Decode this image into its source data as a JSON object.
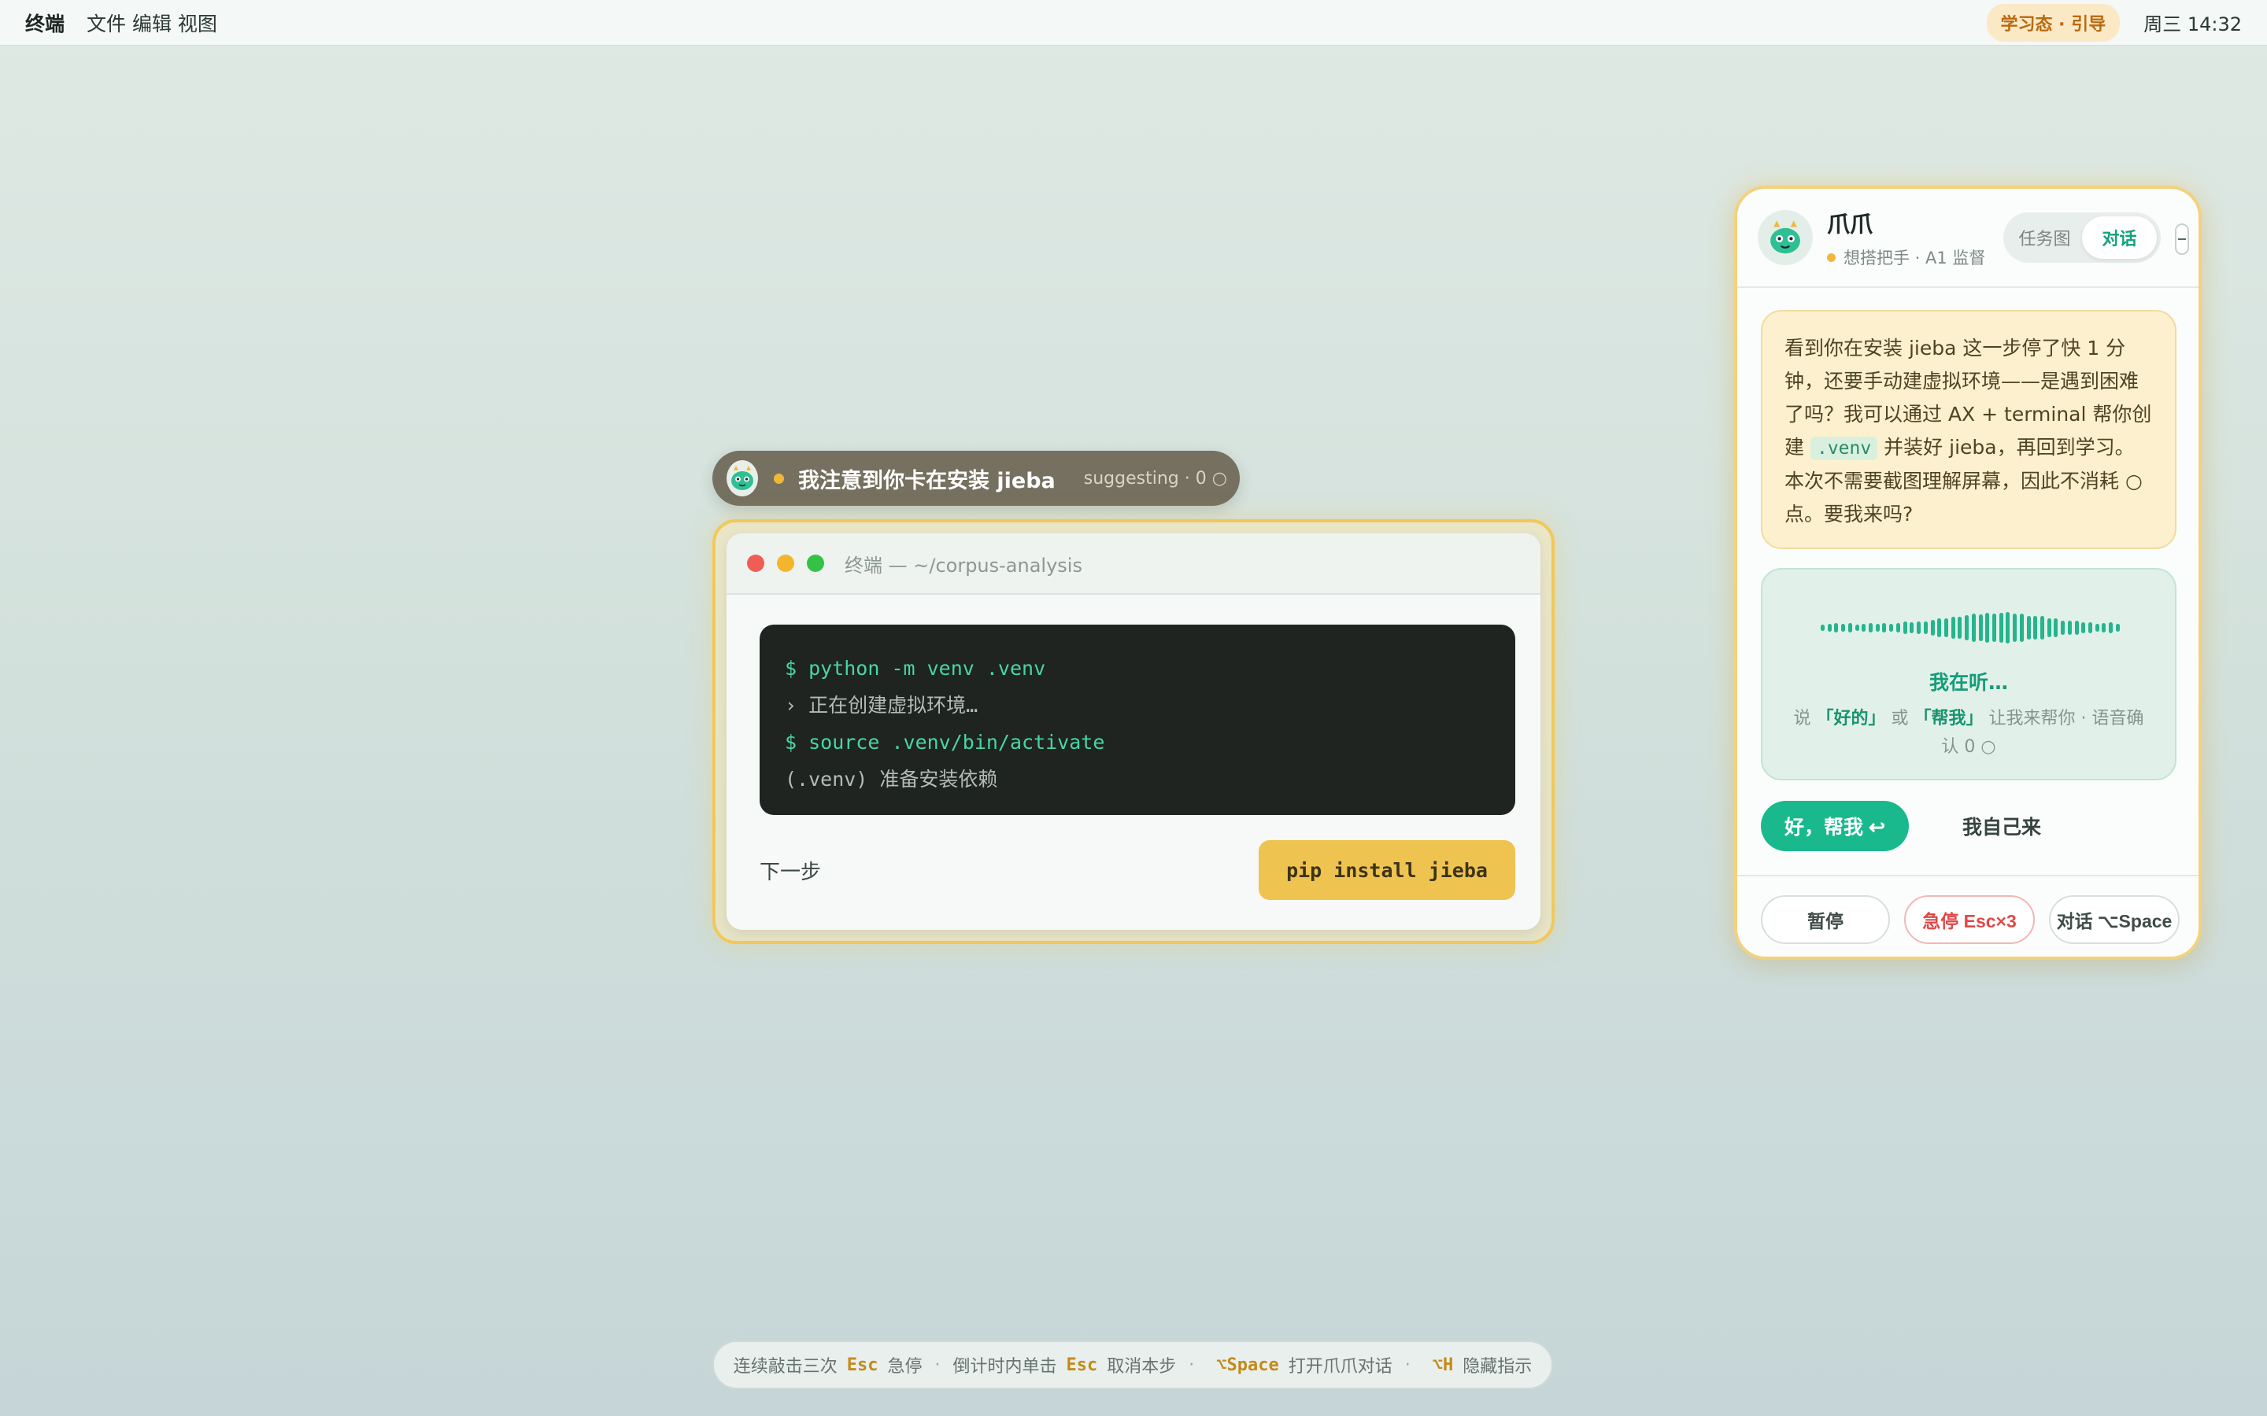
{
  "menubar": {
    "app_name": "终端",
    "menus": "文件 编辑 视图",
    "mode_badge": "学习态 · 引导",
    "clock": "周三 14:32"
  },
  "suggestion": {
    "text": "我注意到你卡在安装 jieba",
    "state": "suggesting · 0 ○"
  },
  "terminal": {
    "title": "终端 — ~/corpus-analysis",
    "lines": [
      "$ python -m venv .venv",
      "› 正在创建虚拟环境…",
      "$ source .venv/bin/activate",
      "(.venv) 准备安装依赖"
    ],
    "next_step_label": "下一步",
    "action_button": "pip install jieba"
  },
  "assistant": {
    "name": "爪爪",
    "subtitle": "想搭把手 · A1 监督",
    "tabs": [
      "任务图",
      "对话"
    ],
    "active_tab": "对话",
    "message_part1": "看到你在安装 jieba 这一步停了快 1 分钟，还要手动建虚拟环境——是遇到困难了吗？我可以通过 AX + terminal 帮你创建",
    "message_code": ".venv",
    "message_part2": "并装好 jieba，再回到学习。本次不需要截图理解屏幕，因此不消耗 ○ 点。要我来吗?",
    "listening_title": "我在听…",
    "hint_say": "说",
    "hint_ok": "「好的」",
    "hint_or": "或",
    "hint_help": "「帮我」",
    "hint_rest": "让我来帮你 · 语音确认 0 ○",
    "help_button": "好，帮我 ↩",
    "self_button": "我自己来",
    "pause_button": "暂停",
    "stop_button": "急停 Esc×3",
    "talk_button": "对话 ⌥Space"
  },
  "shortcuts": {
    "t1": "连续敲击三次",
    "k1": "Esc",
    "t2": "急停",
    "t3": "倒计时内单击",
    "k2": "Esc",
    "t4": "取消本步",
    "k3": "⌥Space",
    "t5": "打开爪爪对话",
    "k4": "⌥H",
    "t6": "隐藏指示"
  },
  "colors": {
    "accent": "#19b98d",
    "highlight": "#f1c859",
    "warning": "#e04848"
  }
}
